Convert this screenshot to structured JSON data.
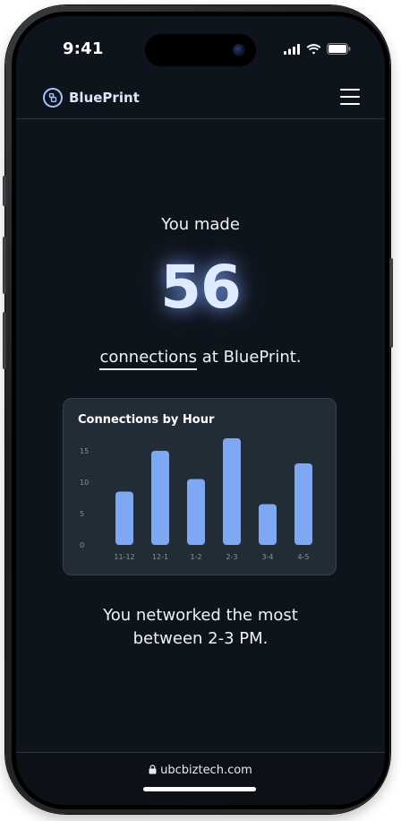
{
  "status_bar": {
    "time": "9:41"
  },
  "nav": {
    "brand_name": "BluePrint",
    "menu_icon": "hamburger-menu-icon"
  },
  "summary": {
    "intro": "You made",
    "count": "56",
    "connections_link": "connections",
    "suffix": " at BluePrint."
  },
  "card": {
    "title": "Connections by Hour"
  },
  "chart_data": {
    "type": "bar",
    "title": "Connections by Hour",
    "xlabel": "",
    "ylabel": "",
    "categories": [
      "11-12",
      "12-1",
      "1-2",
      "2-3",
      "3-4",
      "4-5"
    ],
    "values": [
      8.5,
      15,
      10.5,
      17,
      6.5,
      13
    ],
    "y_ticks": [
      "0",
      "5",
      "10",
      "15"
    ],
    "ylim": [
      0,
      17
    ],
    "grid": false,
    "bar_color": "#7ea9f2"
  },
  "footer": {
    "line1": "You networked the most",
    "line2": "between 2-3 PM."
  },
  "browser": {
    "url": "ubcbiztech.com",
    "lock_icon": "lock-icon"
  },
  "colors": {
    "background": "#0e141b",
    "accent": "#a7c4ff",
    "card": "#222c37"
  }
}
